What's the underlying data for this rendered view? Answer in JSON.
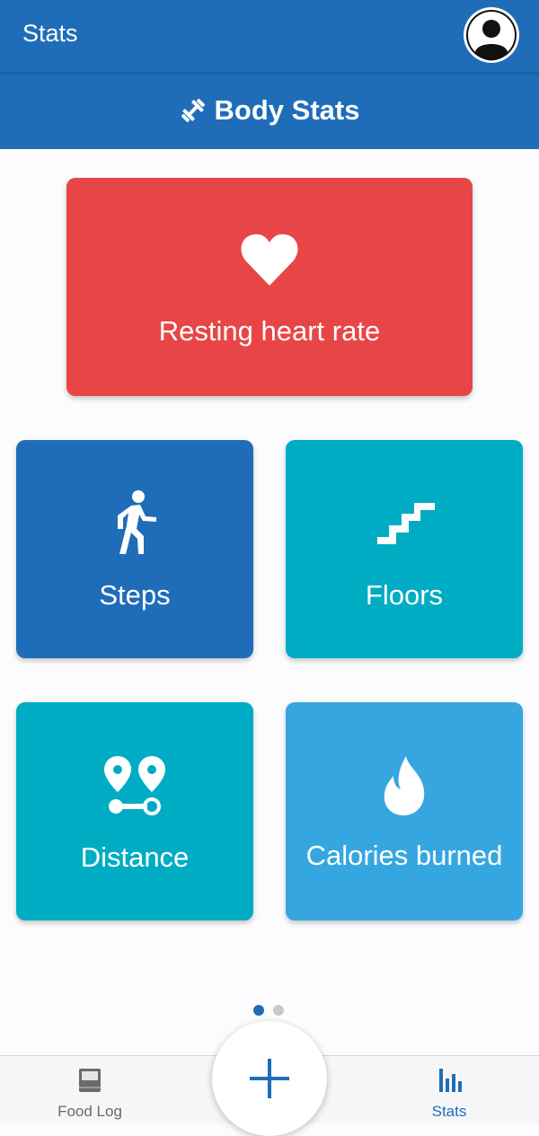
{
  "appbar": {
    "title": "Stats",
    "avatar_icon": "account-circle-icon"
  },
  "section": {
    "title": "Body Stats",
    "icon": "dumbbell-icon"
  },
  "cards": [
    {
      "label": "Resting heart rate",
      "icon": "heart-icon",
      "color": "#e84646"
    },
    {
      "label": "Steps",
      "icon": "walking-person-icon",
      "color": "#1f6db8"
    },
    {
      "label": "Floors",
      "icon": "stairs-icon",
      "color": "#00acc4"
    },
    {
      "label": "Distance",
      "icon": "route-pins-icon",
      "color": "#00acc4"
    },
    {
      "label": "Calories burned",
      "icon": "fire-icon",
      "color": "#36a6e0"
    }
  ],
  "pager": {
    "count": 2,
    "active_index": 0
  },
  "bottom_nav": {
    "items": [
      {
        "label": "Food Log",
        "icon": "book-icon",
        "active": false
      },
      {
        "label": "Stats",
        "icon": "bar-chart-icon",
        "active": true
      }
    ],
    "fab_icon": "plus-icon"
  },
  "colors": {
    "primary": "#1f6db8",
    "accent_cyan": "#00acc4",
    "accent_red": "#e84646",
    "accent_light_blue": "#36a6e0"
  }
}
